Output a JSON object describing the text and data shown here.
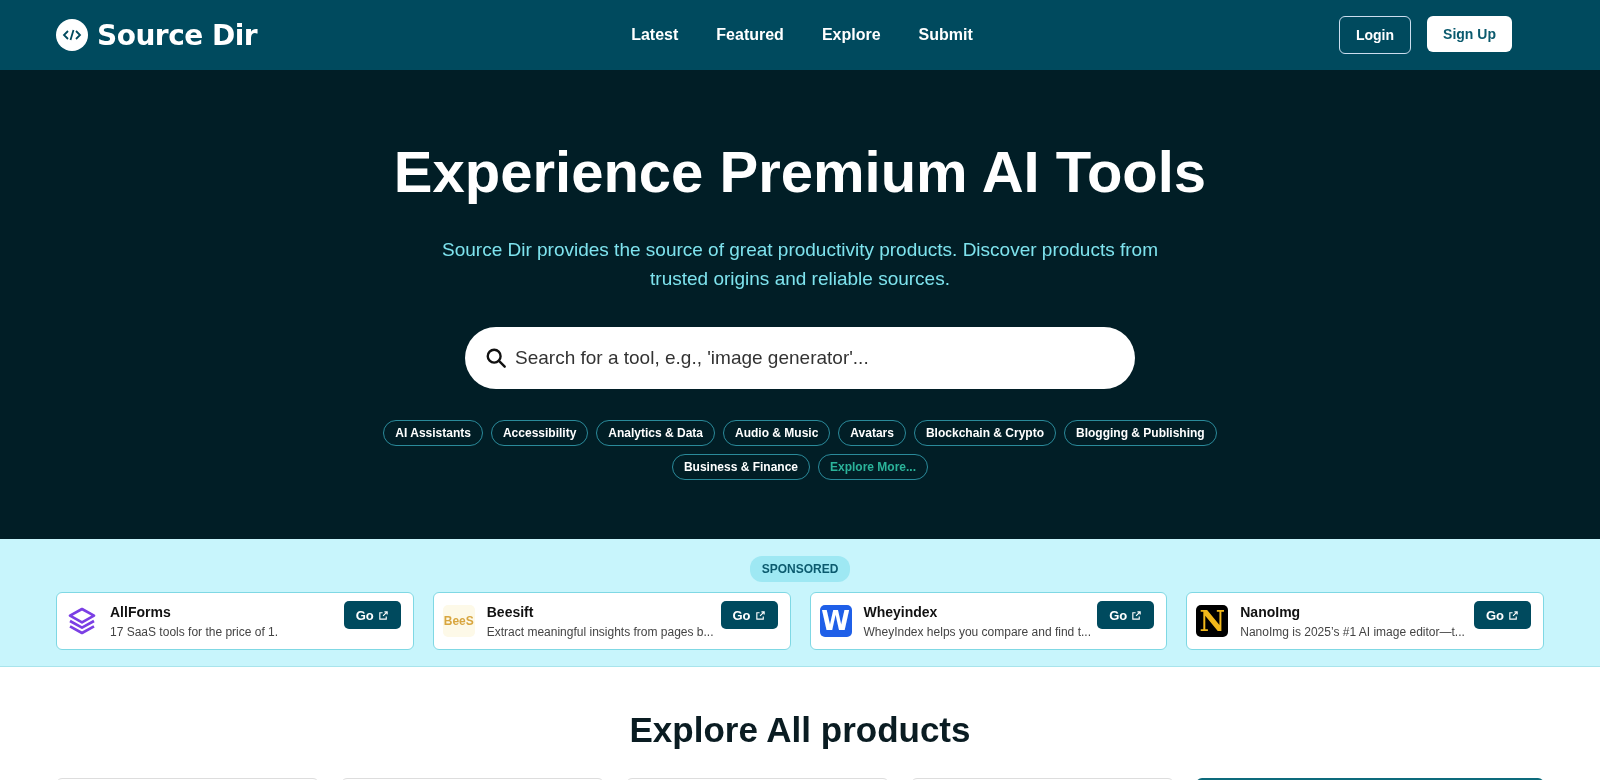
{
  "header": {
    "brand": "Source Dir",
    "nav": [
      "Latest",
      "Featured",
      "Explore",
      "Submit"
    ],
    "login": "Login",
    "signup": "Sign Up"
  },
  "hero": {
    "title": "Experience Premium AI Tools",
    "subtitle": "Source Dir provides the source of great productivity products. Discover products from trusted origins and reliable sources.",
    "search": {
      "placeholder": "Search for a tool, e.g., 'image generator'..."
    },
    "categories": [
      {
        "label": "AI Assistants",
        "kind": "category"
      },
      {
        "label": "Accessibility",
        "kind": "category"
      },
      {
        "label": "Analytics & Data",
        "kind": "category"
      },
      {
        "label": "Audio & Music",
        "kind": "category"
      },
      {
        "label": "Avatars",
        "kind": "category"
      },
      {
        "label": "Blockchain & Crypto",
        "kind": "category"
      },
      {
        "label": "Blogging & Publishing",
        "kind": "category"
      },
      {
        "label": "Business & Finance",
        "kind": "category"
      },
      {
        "label": "Explore More...",
        "kind": "more"
      }
    ]
  },
  "sponsored": {
    "badge": "SPONSORED",
    "items": [
      {
        "name": "AllForms",
        "description": "17 SaaS tools for the price of 1.",
        "logo": {
          "kind": "layers"
        },
        "button": "Go"
      },
      {
        "name": "Beesift",
        "description": "Extract meaningful insights from pages b...",
        "logo": {
          "kind": "wordmark",
          "text": "BeeS"
        },
        "button": "Go"
      },
      {
        "name": "Wheyindex",
        "description": "WheyIndex helps you compare and find t...",
        "logo": {
          "kind": "tile",
          "text": "W"
        },
        "button": "Go"
      },
      {
        "name": "NanoImg",
        "description": "NanoImg is 2025’s #1 AI image editor—t...",
        "logo": {
          "kind": "monogram",
          "text": "N"
        },
        "button": "Go"
      }
    ]
  },
  "products": {
    "title": "Explore All products",
    "cards": [
      {
        "selected": false
      },
      {
        "selected": false
      },
      {
        "selected": false
      },
      {
        "selected": false
      },
      {
        "selected": true
      }
    ]
  }
}
